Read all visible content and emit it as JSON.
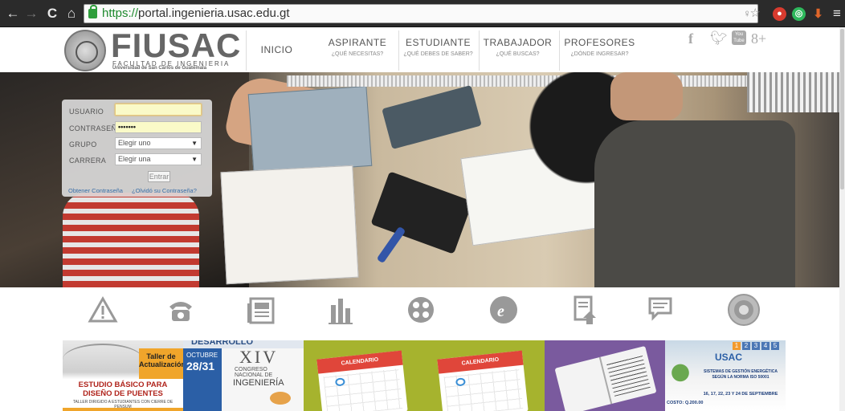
{
  "browser": {
    "url_scheme": "https://",
    "url_rest": "portal.ingenieria.usac.edu.gt"
  },
  "logo": {
    "title": "FIUSAC",
    "subtitle_line1": "FACULTAD DE INGENIERIA",
    "subtitle_line2": "Universidad de San Carlos de Guatemala"
  },
  "menu": [
    {
      "label": "INICIO",
      "sub": ""
    },
    {
      "label": "ASPIRANTE",
      "sub": "¿QUÉ NECESITAS?"
    },
    {
      "label": "ESTUDIANTE",
      "sub": "¿QUÉ DEBES DE SABER?"
    },
    {
      "label": "TRABAJADOR",
      "sub": "¿QUÉ BUSCAS?"
    },
    {
      "label": "PROFESORES",
      "sub": "¿DÓNDE INGRESAR?"
    }
  ],
  "social": [
    "f",
    "You Tube",
    "8+"
  ],
  "login": {
    "usuario_label": "USUARIO",
    "usuario_value": "",
    "password_label": "CONTRASEÑA",
    "password_value": "•••••••",
    "grupo_label": "GRUPO",
    "grupo_value": "Elegir uno",
    "carrera_label": "CARRERA",
    "carrera_value": "Elegir una",
    "enter_label": "Entrar",
    "get_password": "Obtener Contraseña",
    "forgot_password": "¿Olvidó su Contraseña?"
  },
  "banners": {
    "b1_title": "Taller de Actualización",
    "b1_main": "ESTUDIO BÁSICO PARA DISEÑO DE PUENTES",
    "b1_sub": "TALLER DIRIGIDO A ESTUDIANTES CON CIERRE DE PENSUM",
    "b2_top": "DESARROLLO",
    "b2_month": "OCTUBRE",
    "b2_date": "28/31",
    "b2_roman": "XIV",
    "b2_line1": "CONGRESO",
    "b2_line2": "NACIONAL DE",
    "b2_line3": "INGENIERÍA",
    "b3_label": "CALENDARIO",
    "b4_label": "CALENDARIO",
    "b6_pages": [
      "1",
      "2",
      "3",
      "4",
      "5"
    ],
    "b6_brand": "USAC",
    "b6_line1": "SISTEMAS DE GESTIÓN ENERGÉTICA",
    "b6_line2": "SEGÚN LA NORMA ISO 50001",
    "b6_dates": "16, 17, 22, 23 Y 24 DE SEPTIEMBRE",
    "b6_cost": "COSTO: Q.200.00"
  },
  "colors": {
    "calendar_green": "#a6b32e",
    "calendar_red": "#e0463a",
    "purple": "#7a5a9e",
    "link_blue": "#3a6ea8",
    "field_yellow": "#fafac8"
  }
}
